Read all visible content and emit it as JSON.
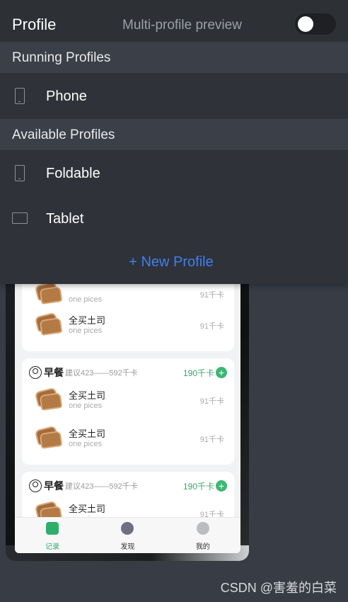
{
  "panel": {
    "title": "Profile",
    "multi_profile_label": "Multi-profile preview",
    "multi_profile_enabled": false,
    "running_section": "Running Profiles",
    "running": [
      {
        "name": "Phone",
        "icon": "phone-icon"
      }
    ],
    "available_section": "Available Profiles",
    "available": [
      {
        "name": "Foldable",
        "icon": "phone-icon"
      },
      {
        "name": "Tablet",
        "icon": "tablet-icon"
      }
    ],
    "new_profile_label": "+ New Profile",
    "accent_color": "#3f7ff0"
  },
  "preview": {
    "card1": {
      "items": [
        {
          "name": "",
          "desc": "one pices",
          "kcal": "91千卡"
        },
        {
          "name": "全买土司",
          "desc": "one pices",
          "kcal": "91千卡"
        }
      ]
    },
    "card2": {
      "meal": "早餐",
      "hint": "建议423——592千卡",
      "kcal": "190千卡",
      "items": [
        {
          "name": "全买土司",
          "desc": "one pices",
          "kcal": "91千卡"
        },
        {
          "name": "全买土司",
          "desc": "one pices",
          "kcal": "91千卡"
        }
      ]
    },
    "card3": {
      "meal": "早餐",
      "hint": "建议423——592千卡",
      "kcal": "190千卡",
      "items": [
        {
          "name": "全买土司",
          "desc": "one pices",
          "kcal": "91千卡"
        }
      ]
    },
    "tabs": [
      {
        "label": "记录",
        "icon": "record-icon",
        "active": true
      },
      {
        "label": "发现",
        "icon": "planet-icon",
        "active": false
      },
      {
        "label": "我的",
        "icon": "user-icon",
        "active": false
      }
    ],
    "accent_color": "#2fae6a"
  },
  "watermark": "CSDN @害羞的白菜"
}
